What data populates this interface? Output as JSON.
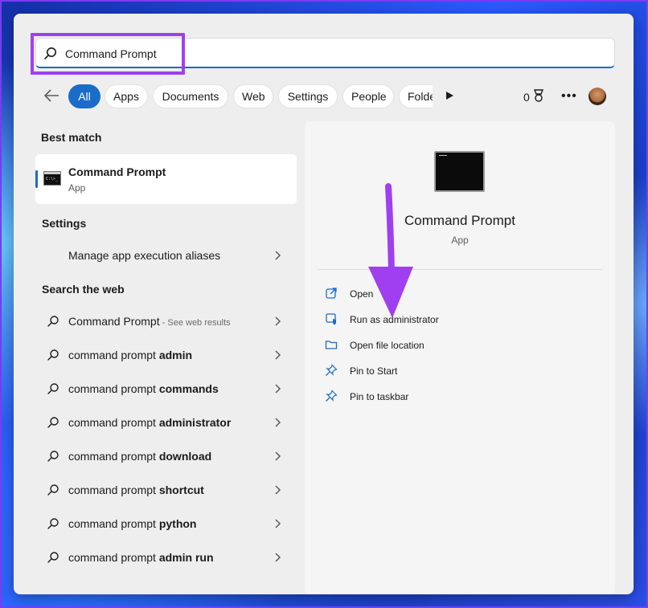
{
  "search": {
    "value": "Command Prompt",
    "placeholder": ""
  },
  "filters": {
    "chips": [
      "All",
      "Apps",
      "Documents",
      "Web",
      "Settings",
      "People",
      "Folde"
    ],
    "points": "0"
  },
  "best_match": {
    "title": "Best match",
    "item": {
      "name": "Command Prompt",
      "type": "App"
    }
  },
  "settings": {
    "title": "Settings",
    "item": "Manage app execution aliases"
  },
  "web": {
    "title": "Search the web",
    "first": {
      "label": "Command Prompt",
      "hint": " - See web results"
    },
    "prefix": "command prompt",
    "suggestions": [
      "admin",
      "commands",
      "administrator",
      "download",
      "shortcut",
      "python",
      "admin run"
    ]
  },
  "detail": {
    "title": "Command Prompt",
    "type": "App",
    "actions": [
      "Open",
      "Run as administrator",
      "Open file location",
      "Pin to Start",
      "Pin to taskbar"
    ]
  },
  "colors": {
    "accent": "#1a6cc9",
    "highlight": "#a03ff0"
  }
}
